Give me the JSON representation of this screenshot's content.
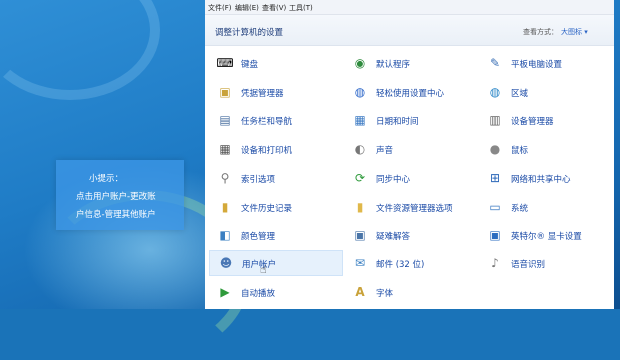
{
  "menu": [
    "文件(F)",
    "编辑(E)",
    "查看(V)",
    "工具(T)"
  ],
  "header": {
    "title": "调整计算机的设置",
    "view_by_label": "查看方式：",
    "view_by_value": "大图标 ▾"
  },
  "tip": {
    "line1": "小提示：",
    "line2": "点击用户账户-更改账",
    "line3": "户信息-管理其他账户"
  },
  "items": [
    {
      "label": "键盘",
      "icon": "keyboard-icon",
      "glyph": "⌨",
      "color": "#555"
    },
    {
      "label": "默认程序",
      "icon": "default-programs-icon",
      "glyph": "◉",
      "color": "#2e8b3d"
    },
    {
      "label": "平板电脑设置",
      "icon": "tablet-icon",
      "glyph": "✎",
      "color": "#3a6fb5"
    },
    {
      "label": "凭据管理器",
      "icon": "credential-manager-icon",
      "glyph": "▣",
      "color": "#c9a23a"
    },
    {
      "label": "轻松使用设置中心",
      "icon": "ease-of-access-icon",
      "glyph": "◍",
      "color": "#2d67c9"
    },
    {
      "label": "区域",
      "icon": "globe-icon",
      "glyph": "◍",
      "color": "#2a86c7"
    },
    {
      "label": "任务栏和导航",
      "icon": "taskbar-icon",
      "glyph": "▤",
      "color": "#4a6fa0"
    },
    {
      "label": "日期和时间",
      "icon": "calendar-icon",
      "glyph": "▦",
      "color": "#3d7bc4"
    },
    {
      "label": "设备管理器",
      "icon": "device-manager-icon",
      "glyph": "▥",
      "color": "#666"
    },
    {
      "label": "设备和打印机",
      "icon": "printer-icon",
      "glyph": "▦",
      "color": "#555"
    },
    {
      "label": "声音",
      "icon": "speaker-icon",
      "glyph": "◐",
      "color": "#777"
    },
    {
      "label": "鼠标",
      "icon": "mouse-icon",
      "glyph": "●",
      "color": "#888"
    },
    {
      "label": "索引选项",
      "icon": "indexing-icon",
      "glyph": "⚲",
      "color": "#777"
    },
    {
      "label": "同步中心",
      "icon": "sync-icon",
      "glyph": "⟳",
      "color": "#2e9a3b"
    },
    {
      "label": "网络和共享中心",
      "icon": "network-icon",
      "glyph": "⊞",
      "color": "#2a66b8"
    },
    {
      "label": "文件历史记录",
      "icon": "file-history-icon",
      "glyph": "▮",
      "color": "#d4a93a"
    },
    {
      "label": "文件资源管理器选项",
      "icon": "folder-options-icon",
      "glyph": "▮",
      "color": "#e0b84a"
    },
    {
      "label": "系统",
      "icon": "system-icon",
      "glyph": "▭",
      "color": "#3a78c2"
    },
    {
      "label": "颜色管理",
      "icon": "color-management-icon",
      "glyph": "◧",
      "color": "#3a7fc2"
    },
    {
      "label": "疑难解答",
      "icon": "troubleshooting-icon",
      "glyph": "▣",
      "color": "#4a75a8"
    },
    {
      "label": "英特尔® 显卡设置",
      "icon": "intel-graphics-icon",
      "glyph": "▣",
      "color": "#2b6cc0"
    },
    {
      "label": "用户帐户",
      "icon": "user-accounts-icon",
      "glyph": "☻",
      "color": "#4a78b5"
    },
    {
      "label": "邮件 (32 位)",
      "icon": "mail-icon",
      "glyph": "✉",
      "color": "#3a7fc2"
    },
    {
      "label": "语音识别",
      "icon": "microphone-icon",
      "glyph": "♪",
      "color": "#777"
    },
    {
      "label": "自动播放",
      "icon": "autoplay-icon",
      "glyph": "▶",
      "color": "#2e9a3b"
    },
    {
      "label": "字体",
      "icon": "fonts-icon",
      "glyph": "A",
      "color": "#c9a23a"
    }
  ]
}
